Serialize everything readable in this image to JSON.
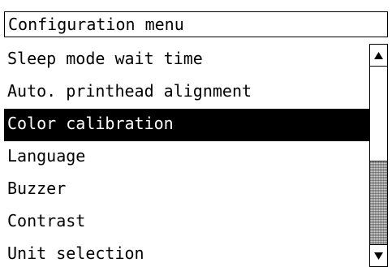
{
  "title": "Configuration menu",
  "menu": {
    "items": [
      {
        "label": "Sleep mode wait time",
        "selected": false
      },
      {
        "label": "Auto. printhead alignment",
        "selected": false
      },
      {
        "label": "Color calibration",
        "selected": true
      },
      {
        "label": "Language",
        "selected": false
      },
      {
        "label": "Buzzer",
        "selected": false
      },
      {
        "label": "Contrast",
        "selected": false
      },
      {
        "label": "Unit selection",
        "selected": false
      }
    ]
  },
  "scrollbar": {
    "up_icon": "up-arrow-icon",
    "down_icon": "down-arrow-icon"
  },
  "colors": {
    "background": "#ffffff",
    "foreground": "#000000",
    "selection_background": "#000000",
    "selection_text": "#ffffff",
    "scroll_thumb": "#d7d7d7"
  }
}
